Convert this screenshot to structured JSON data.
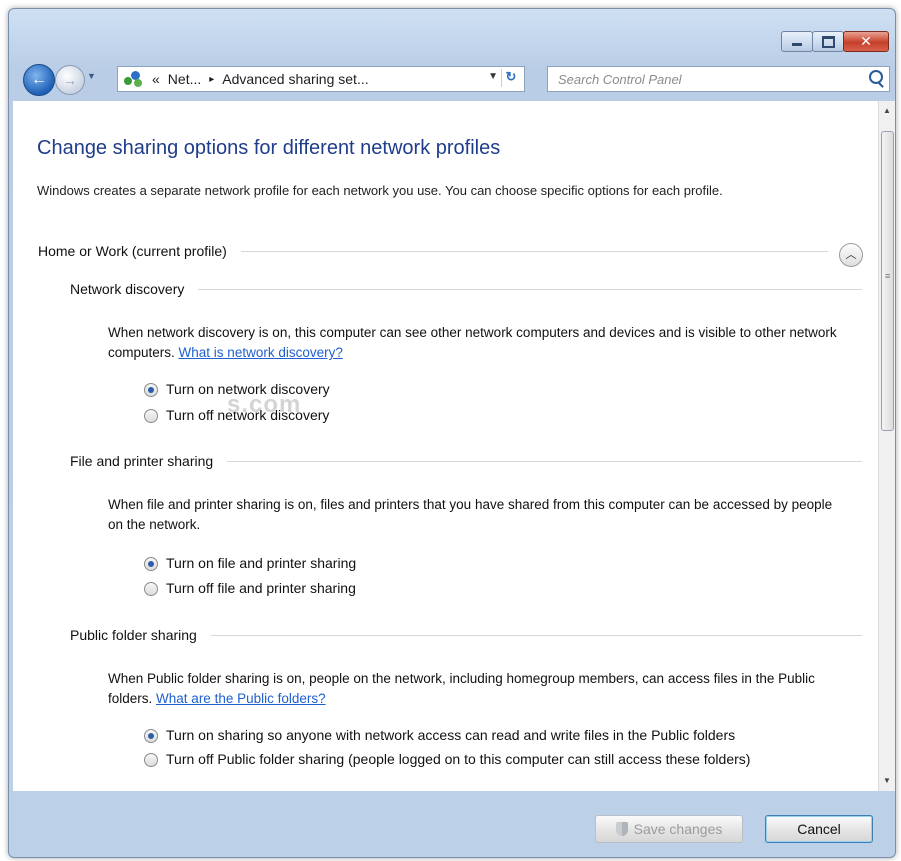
{
  "window": {
    "minimize_icon": "minimize-icon",
    "maximize_icon": "maximize-icon",
    "close_icon": "close-icon"
  },
  "navigation": {
    "address_prefix": "«",
    "address_segments": [
      "Net...",
      "Advanced sharing set..."
    ],
    "separator": "▸",
    "search_placeholder": "Search Control Panel"
  },
  "content": {
    "title": "Change sharing options for different network profiles",
    "description": "Windows creates a separate network profile for each network you use. You can choose specific options for each profile.",
    "profile": "Home or Work (current profile)",
    "sections": {
      "network_discovery": {
        "heading": "Network discovery",
        "text": "When network discovery is on, this computer can see other network computers and devices and is visible to other network computers.",
        "link": "What is network discovery?",
        "options": [
          "Turn on network discovery",
          "Turn off network discovery"
        ],
        "selected": 0
      },
      "file_printer": {
        "heading": "File and printer sharing",
        "text": "When file and printer sharing is on, files and printers that you have shared from this computer can be accessed by people on the network.",
        "options": [
          "Turn on file and printer sharing",
          "Turn off file and printer sharing"
        ],
        "selected": 0
      },
      "public_folder": {
        "heading": "Public folder sharing",
        "text": "When Public folder sharing is on, people on the network, including homegroup members, can access files in the Public folders.",
        "link": "What are the Public folders?",
        "options": [
          "Turn on sharing so anyone with network access can read and write files in the Public folders",
          "Turn off Public folder sharing (people logged on to this computer can still access these folders)"
        ],
        "selected": 0
      }
    },
    "watermark": "s.com"
  },
  "footer": {
    "save_label": "Save changes",
    "cancel_label": "Cancel"
  },
  "colors": {
    "title": "#1e3d8a",
    "link": "#1f5fcf",
    "radio_selected": "#2d5da8"
  }
}
